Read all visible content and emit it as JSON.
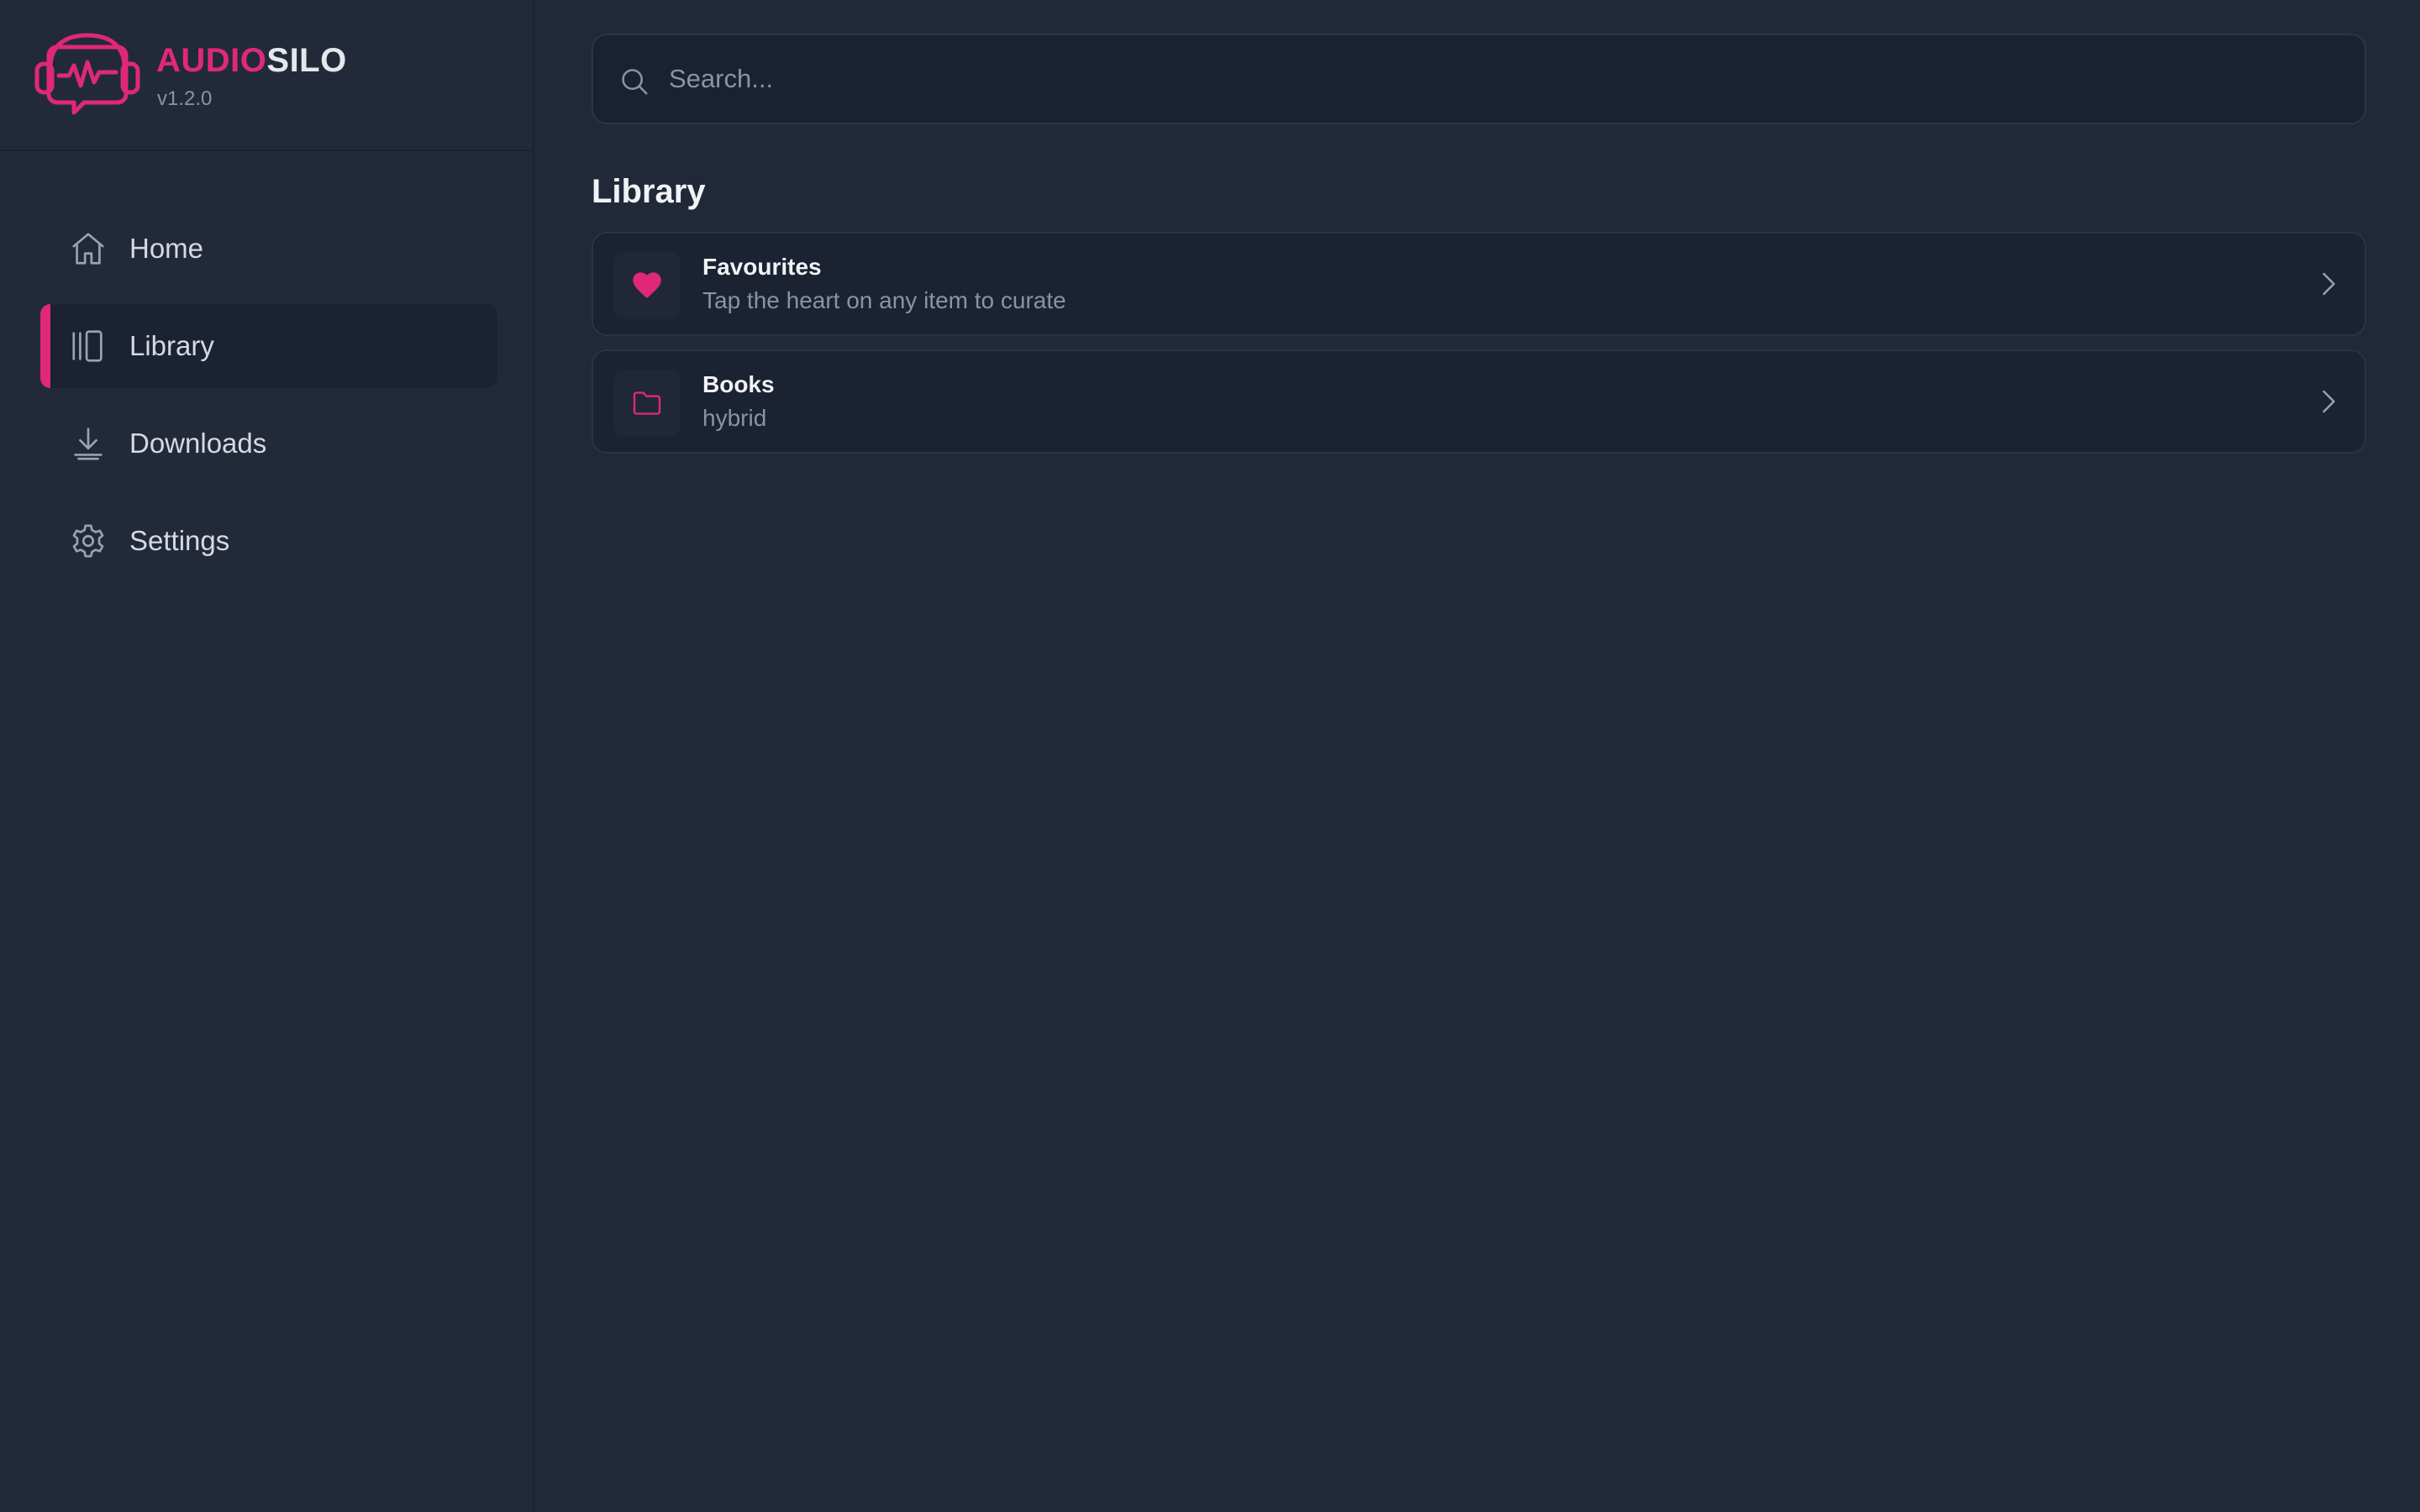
{
  "brand": {
    "name_part1": "AUDIO",
    "name_part2": "SILO",
    "version": "v1.2.0"
  },
  "sidebar": {
    "items": [
      {
        "label": "Home",
        "icon": "home-icon",
        "active": false
      },
      {
        "label": "Library",
        "icon": "library-icon",
        "active": true
      },
      {
        "label": "Downloads",
        "icon": "download-icon",
        "active": false
      },
      {
        "label": "Settings",
        "icon": "gear-icon",
        "active": false
      }
    ]
  },
  "search": {
    "placeholder": "Search...",
    "value": ""
  },
  "main": {
    "section_title": "Library",
    "items": [
      {
        "title": "Favourites",
        "subtitle": "Tap the heart on any item to curate",
        "icon": "heart-icon"
      },
      {
        "title": "Books",
        "subtitle": "hybrid",
        "icon": "folder-icon"
      }
    ]
  },
  "colors": {
    "accent": "#e0287a",
    "background": "#212939",
    "card": "#1b2232"
  }
}
